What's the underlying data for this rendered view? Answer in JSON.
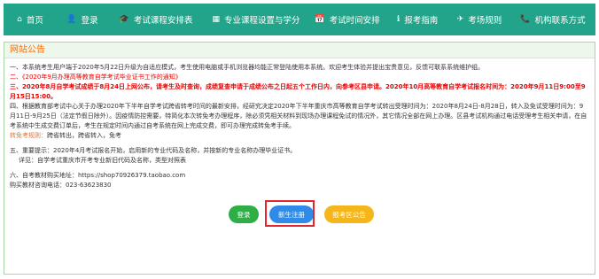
{
  "nav": {
    "items": [
      {
        "icon": "⌂",
        "label": "首页"
      },
      {
        "icon": "👤",
        "label": "登录"
      },
      {
        "icon": "🎓",
        "label": "考试课程安排表"
      },
      {
        "icon": "▦",
        "label": "专业课程设置与学分"
      },
      {
        "icon": "📅",
        "label": "考试时间安排"
      },
      {
        "icon": "ℹ",
        "label": "报考指南"
      },
      {
        "icon": "✈",
        "label": "考场规则"
      },
      {
        "icon": "📞",
        "label": "机构联系方式"
      }
    ]
  },
  "notice": {
    "title": "网站公告",
    "line1": "一、本系统考生用户端于2020年5月22日升级为自适应模式，考生使用电脑或手机浏览器均能正常登陆使用本系统。欢迎考生体验并提出宝贵意见，反馈可联系系统维护组。",
    "line2": "二、《2020年9月办理高等教育自学考试毕业证书工作的通知》",
    "line3": "三、2020年8月自学考试成绩于8月24日上网公布，请考生及时查询，成绩复查申请于成绩公布之日起五个工作日内，向参考区县申请。2020年10月高等教育自学考试报名时间为：2020年9月11日9:00至9月15日15:00。",
    "line4": "四、根据教育部考试中心关于办理2020年下半年自学考试跨省转考时间的最新安排，经研究决定2020年下半年重庆市高等教育自学考试转出受理时间为：2020年8月24日-8月28日，转入及免试受理时间为：9月11日-9月25日（法定节假日除外）。因疫情防控需要，特简化本次转免考办理程序，除必须凭相关材料到现场办理课程免试的情况外，其它情况全部在网上办理。区县考试机构通过电话受理考生相关申请，在自考系统中生成交费订单后，考生在规定时间内通过自考系统在网上完成交费，即可办理完成转免考手续。",
    "line5_label": "转免考规则：",
    "line5": "跨省转出，跨省转入，免考",
    "line6": "五、重要提示：2020年4月考试报名开始，启用新的专业代码及名称，并按新的专业名称办理毕业证书。",
    "line7": "详见：自学考试重庆市开考专业新旧代码及名称，类型对照表",
    "line8": "六、自考教材购买地址：https://shop70926379.taobao.com",
    "line9": "购买教材咨询电话：023-63623830"
  },
  "buttons": {
    "login": "登录",
    "register": "新生注册",
    "exam_notice": "报考区公告"
  }
}
